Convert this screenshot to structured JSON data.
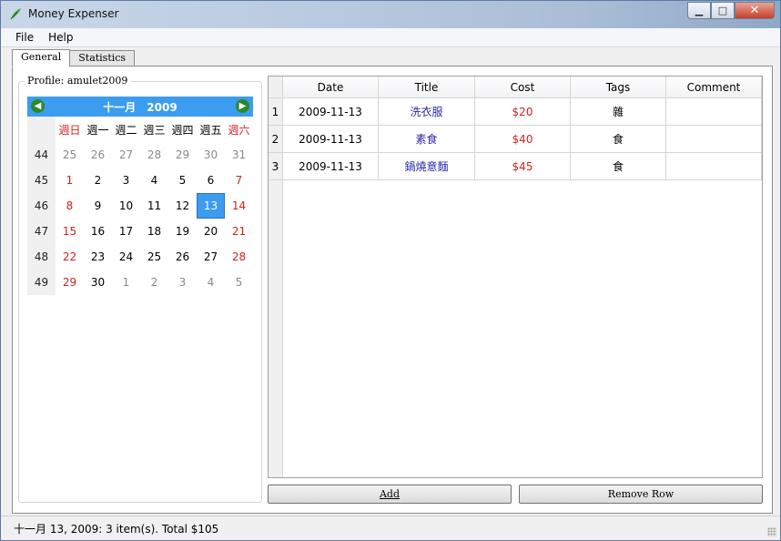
{
  "window": {
    "title": "Money Expenser",
    "controls": {
      "minimize": "▁",
      "maximize": "□",
      "close": "✕"
    }
  },
  "menu": [
    {
      "label": "File"
    },
    {
      "label": "Help"
    }
  ],
  "tabs": [
    {
      "label": "General",
      "active": true
    },
    {
      "label": "Statistics",
      "active": false
    }
  ],
  "profile": {
    "label": "Profile: amulet2009"
  },
  "calendar": {
    "month": "十一月",
    "year": "2009",
    "weekdays": [
      "週日",
      "週一",
      "週二",
      "週三",
      "週四",
      "週五",
      "週六"
    ],
    "selected_day": "13",
    "weeks": [
      {
        "week": "44",
        "days": [
          "25",
          "26",
          "27",
          "28",
          "29",
          "30",
          "31"
        ],
        "other": [
          true,
          true,
          true,
          true,
          true,
          true,
          true
        ]
      },
      {
        "week": "45",
        "days": [
          "1",
          "2",
          "3",
          "4",
          "5",
          "6",
          "7"
        ],
        "other": [
          false,
          false,
          false,
          false,
          false,
          false,
          false
        ]
      },
      {
        "week": "46",
        "days": [
          "8",
          "9",
          "10",
          "11",
          "12",
          "13",
          "14"
        ],
        "other": [
          false,
          false,
          false,
          false,
          false,
          false,
          false
        ]
      },
      {
        "week": "47",
        "days": [
          "15",
          "16",
          "17",
          "18",
          "19",
          "20",
          "21"
        ],
        "other": [
          false,
          false,
          false,
          false,
          false,
          false,
          false
        ]
      },
      {
        "week": "48",
        "days": [
          "22",
          "23",
          "24",
          "25",
          "26",
          "27",
          "28"
        ],
        "other": [
          false,
          false,
          false,
          false,
          false,
          false,
          false
        ]
      },
      {
        "week": "49",
        "days": [
          "29",
          "30",
          "1",
          "2",
          "3",
          "4",
          "5"
        ],
        "other": [
          false,
          false,
          true,
          true,
          true,
          true,
          true
        ]
      }
    ],
    "colors": {
      "header": "#3c9cf0",
      "weekend": "#d42020",
      "selected": "#3c9cf0"
    }
  },
  "table": {
    "columns": [
      "Date",
      "Title",
      "Cost",
      "Tags",
      "Comment"
    ],
    "rows": [
      {
        "num": "1",
        "date": "2009-11-13",
        "title": "洗衣服",
        "cost": "$20",
        "tags": "雜",
        "comment": ""
      },
      {
        "num": "2",
        "date": "2009-11-13",
        "title": "素食",
        "cost": "$40",
        "tags": "食",
        "comment": ""
      },
      {
        "num": "3",
        "date": "2009-11-13",
        "title": "鍋燒意麵",
        "cost": "$45",
        "tags": "食",
        "comment": ""
      }
    ],
    "colors": {
      "title": "#2a2aaa",
      "cost": "#d42020"
    }
  },
  "buttons": {
    "add": "Add",
    "remove": "Remove Row"
  },
  "status": {
    "text": "十一月 13, 2009:   3 item(s). Total $105"
  }
}
